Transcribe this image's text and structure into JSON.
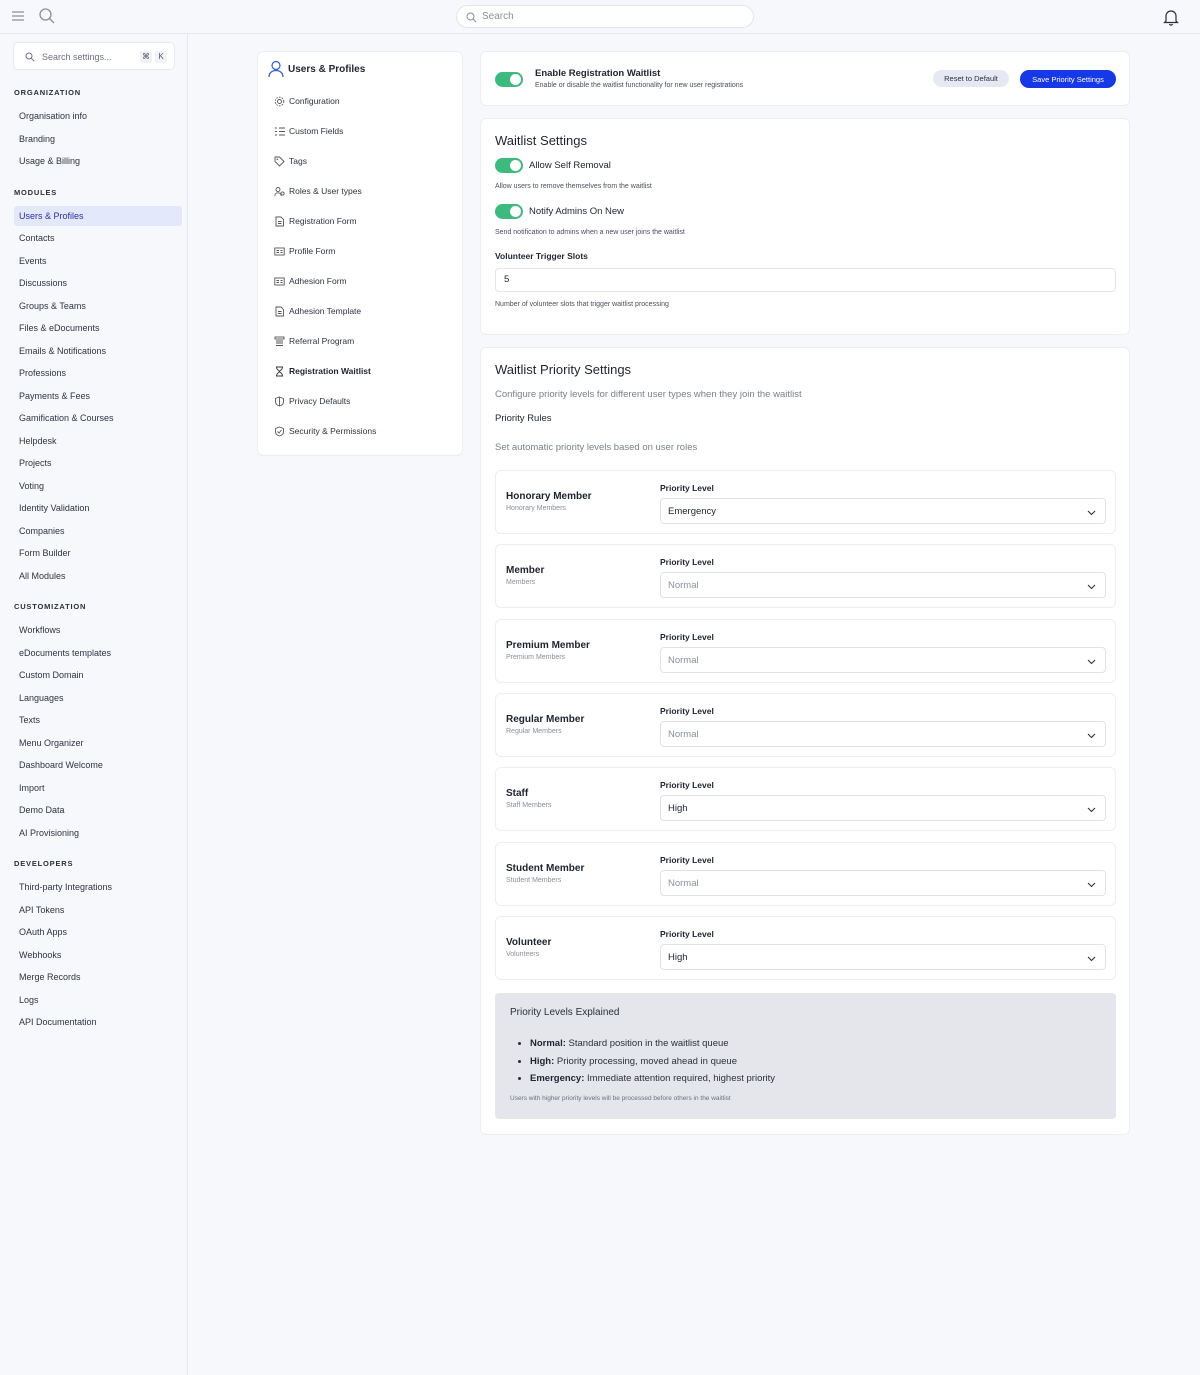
{
  "topbar": {
    "search_placeholder": "Search"
  },
  "sidebar": {
    "search_placeholder": "Search settings...",
    "kbd_cmd": "⌘",
    "kbd_k": "K",
    "sections": [
      {
        "title": "ORGANIZATION",
        "items": [
          "Organisation info",
          "Branding",
          "Usage & Billing"
        ]
      },
      {
        "title": "MODULES",
        "items": [
          "Users & Profiles",
          "Contacts",
          "Events",
          "Discussions",
          "Groups & Teams",
          "Files & eDocuments",
          "Emails & Notifications",
          "Professions",
          "Payments & Fees",
          "Gamification & Courses",
          "Helpdesk",
          "Projects",
          "Voting",
          "Identity Validation",
          "Companies",
          "Form Builder",
          "All Modules"
        ]
      },
      {
        "title": "CUSTOMIZATION",
        "items": [
          "Workflows",
          "eDocuments templates",
          "Custom Domain",
          "Languages",
          "Texts",
          "Menu Organizer",
          "Dashboard Welcome",
          "Import",
          "Demo Data",
          "AI Provisioning"
        ]
      },
      {
        "title": "DEVELOPERS",
        "items": [
          "Third-party Integrations",
          "API Tokens",
          "OAuth Apps",
          "Webhooks",
          "Merge Records",
          "Logs",
          "API Documentation"
        ]
      }
    ],
    "active_item": "Users & Profiles"
  },
  "subnav": {
    "title": "Users & Profiles",
    "items": [
      {
        "label": "Configuration",
        "icon": "gear-icon"
      },
      {
        "label": "Custom Fields",
        "icon": "list-icon"
      },
      {
        "label": "Tags",
        "icon": "tag-icon"
      },
      {
        "label": "Roles & User types",
        "icon": "users-icon"
      },
      {
        "label": "Registration Form",
        "icon": "document-icon"
      },
      {
        "label": "Profile Form",
        "icon": "id-card-icon"
      },
      {
        "label": "Adhesion Form",
        "icon": "id-card-icon"
      },
      {
        "label": "Adhesion Template",
        "icon": "document-icon"
      },
      {
        "label": "Referral Program",
        "icon": "network-icon"
      },
      {
        "label": "Registration Waitlist",
        "icon": "hourglass-icon"
      },
      {
        "label": "Privacy Defaults",
        "icon": "shield-icon"
      },
      {
        "label": "Security & Permissions",
        "icon": "shield-check-icon"
      }
    ],
    "active_item": "Registration Waitlist"
  },
  "enable_card": {
    "title": "Enable Registration Waitlist",
    "description": "Enable or disable the waitlist functionality for new user registrations",
    "enabled": true,
    "reset_label": "Reset to Default",
    "save_label": "Save Priority Settings"
  },
  "waitlist_settings": {
    "title": "Waitlist Settings",
    "self_removal_label": "Allow Self Removal",
    "self_removal_help": "Allow users to remove themselves from the waitlist",
    "notify_label": "Notify Admins On New",
    "notify_help": "Send notification to admins when a new user joins the waitlist",
    "slots_label": "Volunteer Trigger Slots",
    "slots_value": "5",
    "slots_help": "Number of volunteer slots that trigger waitlist processing"
  },
  "priority_settings": {
    "title": "Waitlist Priority Settings",
    "description": "Configure priority levels for different user types when they join the waitlist",
    "rules_label": "Priority Rules",
    "rules_help": "Set automatic priority levels based on user roles",
    "level_label": "Priority Level",
    "rows": [
      {
        "role": "Honorary Member",
        "sub": "Honorary Members",
        "value": "Emergency",
        "placeholder": false
      },
      {
        "role": "Member",
        "sub": "Members",
        "value": "Normal",
        "placeholder": true
      },
      {
        "role": "Premium Member",
        "sub": "Premium Members",
        "value": "Normal",
        "placeholder": true
      },
      {
        "role": "Regular Member",
        "sub": "Regular Members",
        "value": "Normal",
        "placeholder": true
      },
      {
        "role": "Staff",
        "sub": "Staff Members",
        "value": "High",
        "placeholder": false
      },
      {
        "role": "Student Member",
        "sub": "Student Members",
        "value": "Normal",
        "placeholder": true
      },
      {
        "role": "Volunteer",
        "sub": "Volunteers",
        "value": "High",
        "placeholder": false
      }
    ],
    "explain": {
      "title": "Priority Levels Explained",
      "items": [
        {
          "term": "Normal:",
          "text": " Standard position in the waitlist queue"
        },
        {
          "term": "High:",
          "text": " Priority processing, moved ahead in queue"
        },
        {
          "term": "Emergency:",
          "text": " Immediate attention required, highest priority"
        }
      ],
      "note": "Users with higher priority levels will be processed before others in the waitlist"
    }
  }
}
